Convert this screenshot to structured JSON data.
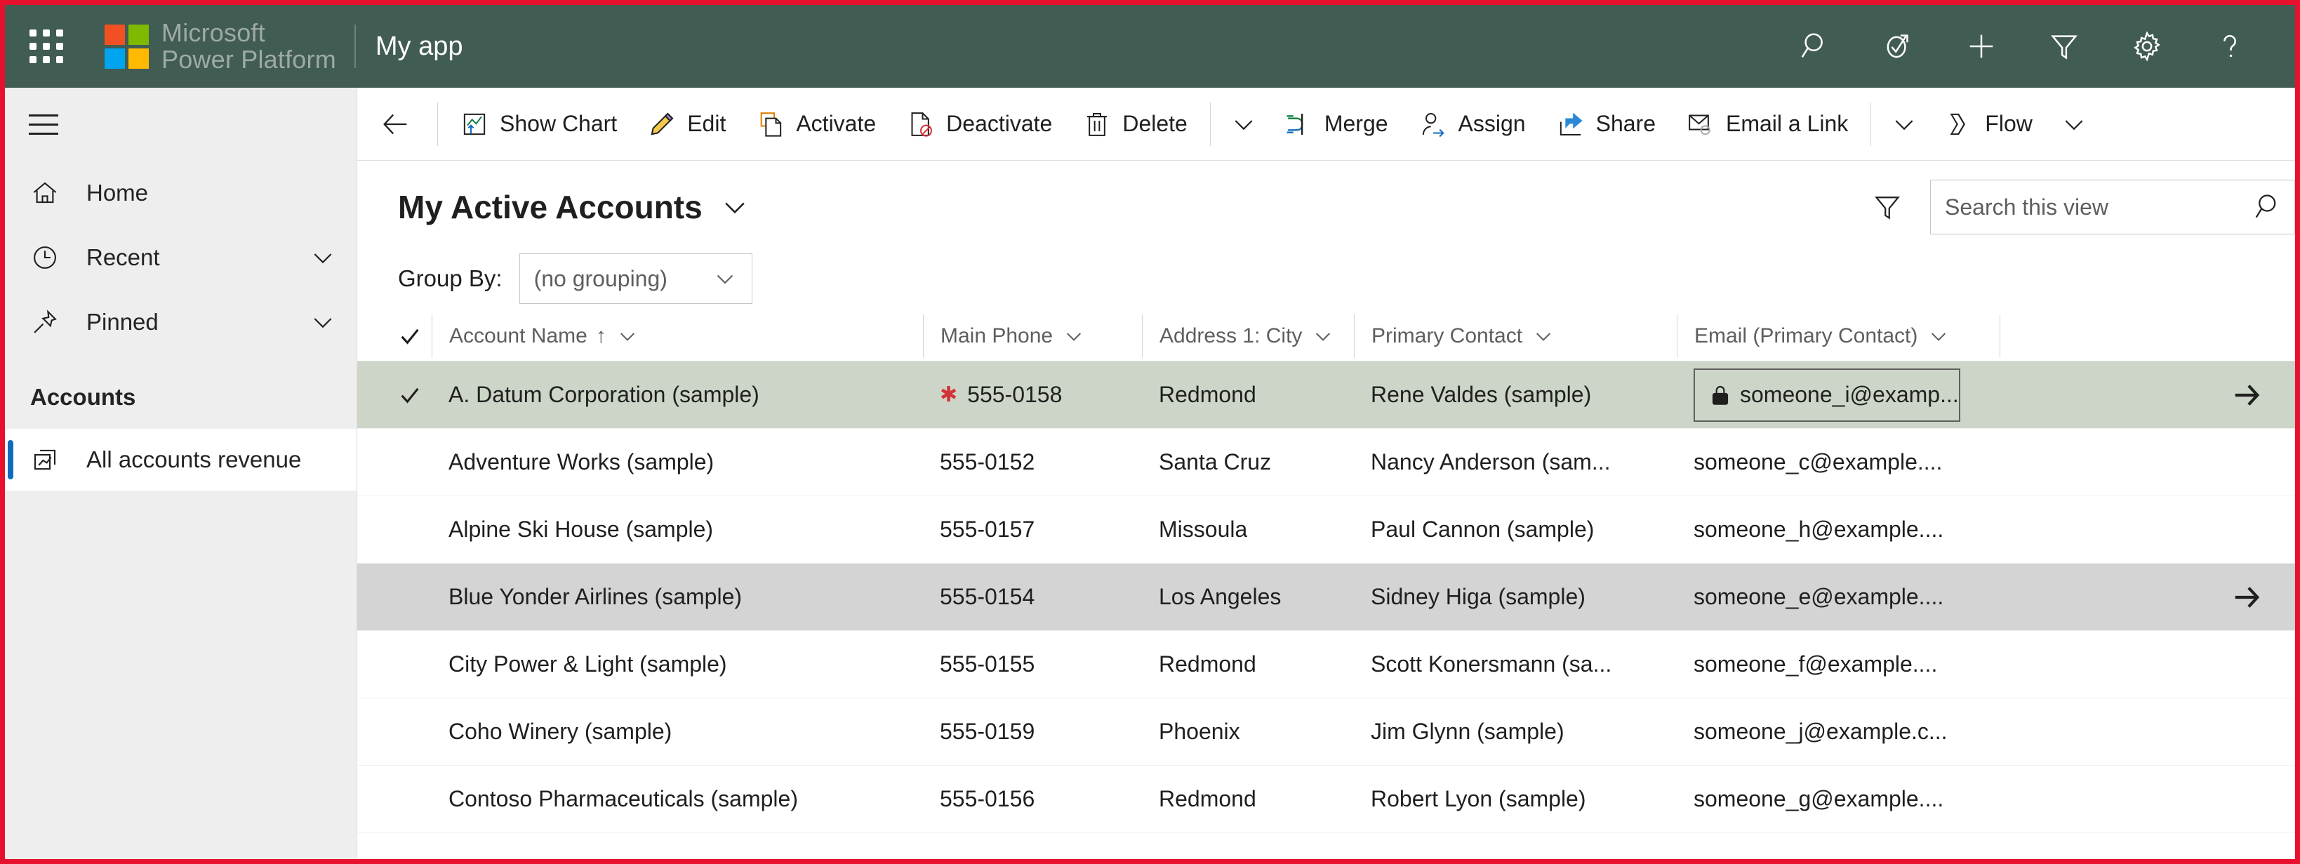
{
  "brand": {
    "line1": "Microsoft",
    "line2": "Power Platform",
    "app_title": "My app",
    "waffle_icon": "app-launcher-waffle-icon",
    "header_bg": "#415c53"
  },
  "header_icons": [
    {
      "name": "search-icon",
      "label": "Search"
    },
    {
      "name": "relationship-assistant-icon",
      "label": "Assistant"
    },
    {
      "name": "plus-icon",
      "label": "New"
    },
    {
      "name": "filter-icon",
      "label": "Filter"
    },
    {
      "name": "gear-icon",
      "label": "Settings"
    },
    {
      "name": "help-question-icon",
      "label": "Help"
    }
  ],
  "sidebar": {
    "hamburger_label": "Expand navigation",
    "items": [
      {
        "label": "Home",
        "icon": "home-icon",
        "chevron": false
      },
      {
        "label": "Recent",
        "icon": "clock-icon",
        "chevron": true
      },
      {
        "label": "Pinned",
        "icon": "pin-icon",
        "chevron": true
      }
    ],
    "section_title": "Accounts",
    "entities": [
      {
        "label": "All accounts revenue",
        "icon": "chart-entity-icon",
        "selected": true
      }
    ]
  },
  "commandbar": {
    "back_label": "Back",
    "buttons": [
      {
        "label": "Show Chart",
        "icon": "show-chart-icon"
      },
      {
        "label": "Edit",
        "icon": "pencil-edit-icon"
      },
      {
        "label": "Activate",
        "icon": "activate-document-icon"
      },
      {
        "label": "Deactivate",
        "icon": "deactivate-document-icon"
      },
      {
        "label": "Delete",
        "icon": "trash-delete-icon"
      }
    ],
    "overflow_1": "chevron-down-icon",
    "buttons2": [
      {
        "label": "Merge",
        "icon": "merge-icon"
      },
      {
        "label": "Assign",
        "icon": "assign-person-icon"
      },
      {
        "label": "Share",
        "icon": "share-icon"
      },
      {
        "label": "Email a Link",
        "icon": "email-link-icon"
      }
    ],
    "overflow_2": "chevron-down-icon",
    "flow": {
      "label": "Flow",
      "icon": "flow-icon",
      "chevron": "chevron-down-icon"
    }
  },
  "view": {
    "title": "My Active Accounts",
    "title_chevron": "chevron-down-icon",
    "filter_icon": "filter-icon",
    "group_by_label": "Group By:",
    "group_by_value": "(no grouping)",
    "group_by_chevron": "chevron-down-icon"
  },
  "search": {
    "placeholder": "Search this view",
    "value": "",
    "icon": "search-icon"
  },
  "grid": {
    "select_all_icon": "checkmark-icon",
    "columns": [
      {
        "key": "name",
        "label": "Account Name",
        "sort": "↑",
        "chevron": true
      },
      {
        "key": "phone",
        "label": "Main Phone",
        "sort": "",
        "chevron": true
      },
      {
        "key": "city",
        "label": "Address 1: City",
        "sort": "",
        "chevron": true
      },
      {
        "key": "contact",
        "label": "Primary Contact",
        "sort": "",
        "chevron": true
      },
      {
        "key": "email",
        "label": "Email (Primary Contact)",
        "sort": "",
        "chevron": true
      }
    ],
    "rows": [
      {
        "name": "A. Datum Corporation (sample)",
        "phone": "555-0158",
        "phone_required": true,
        "city": "Redmond",
        "contact": "Rene Valdes (sample)",
        "email": "someone_i@examp...",
        "email_locked": true,
        "email_focused": true,
        "state": "selected",
        "checked": true,
        "show_arrow": true
      },
      {
        "name": "Adventure Works (sample)",
        "phone": "555-0152",
        "phone_required": false,
        "city": "Santa Cruz",
        "contact": "Nancy Anderson (sam...",
        "email": "someone_c@example....",
        "email_locked": false,
        "email_focused": false,
        "state": "normal",
        "checked": false,
        "show_arrow": false
      },
      {
        "name": "Alpine Ski House (sample)",
        "phone": "555-0157",
        "phone_required": false,
        "city": "Missoula",
        "contact": "Paul Cannon (sample)",
        "email": "someone_h@example....",
        "email_locked": false,
        "email_focused": false,
        "state": "normal",
        "checked": false,
        "show_arrow": false
      },
      {
        "name": "Blue Yonder Airlines (sample)",
        "phone": "555-0154",
        "phone_required": false,
        "city": "Los Angeles",
        "contact": "Sidney Higa (sample)",
        "email": "someone_e@example....",
        "email_locked": false,
        "email_focused": false,
        "state": "hovered",
        "checked": false,
        "show_arrow": true
      },
      {
        "name": "City Power & Light (sample)",
        "phone": "555-0155",
        "phone_required": false,
        "city": "Redmond",
        "contact": "Scott Konersmann (sa...",
        "email": "someone_f@example....",
        "email_locked": false,
        "email_focused": false,
        "state": "normal",
        "checked": false,
        "show_arrow": false
      },
      {
        "name": "Coho Winery (sample)",
        "phone": "555-0159",
        "phone_required": false,
        "city": "Phoenix",
        "contact": "Jim Glynn (sample)",
        "email": "someone_j@example.c...",
        "email_locked": false,
        "email_focused": false,
        "state": "normal",
        "checked": false,
        "show_arrow": false
      },
      {
        "name": "Contoso Pharmaceuticals (sample)",
        "phone": "555-0156",
        "phone_required": false,
        "city": "Redmond",
        "contact": "Robert Lyon (sample)",
        "email": "someone_g@example....",
        "email_locked": false,
        "email_focused": false,
        "state": "normal",
        "checked": false,
        "show_arrow": false
      }
    ]
  },
  "colors": {
    "header_bg": "#415c53",
    "selected_row": "#ccd5c8",
    "hover_row": "#d4d4d4",
    "sidebar_bg": "#efeeee",
    "accent_blue": "#0f6cbd",
    "required_red": "#d13438",
    "annotation_border": "#e8112d"
  }
}
